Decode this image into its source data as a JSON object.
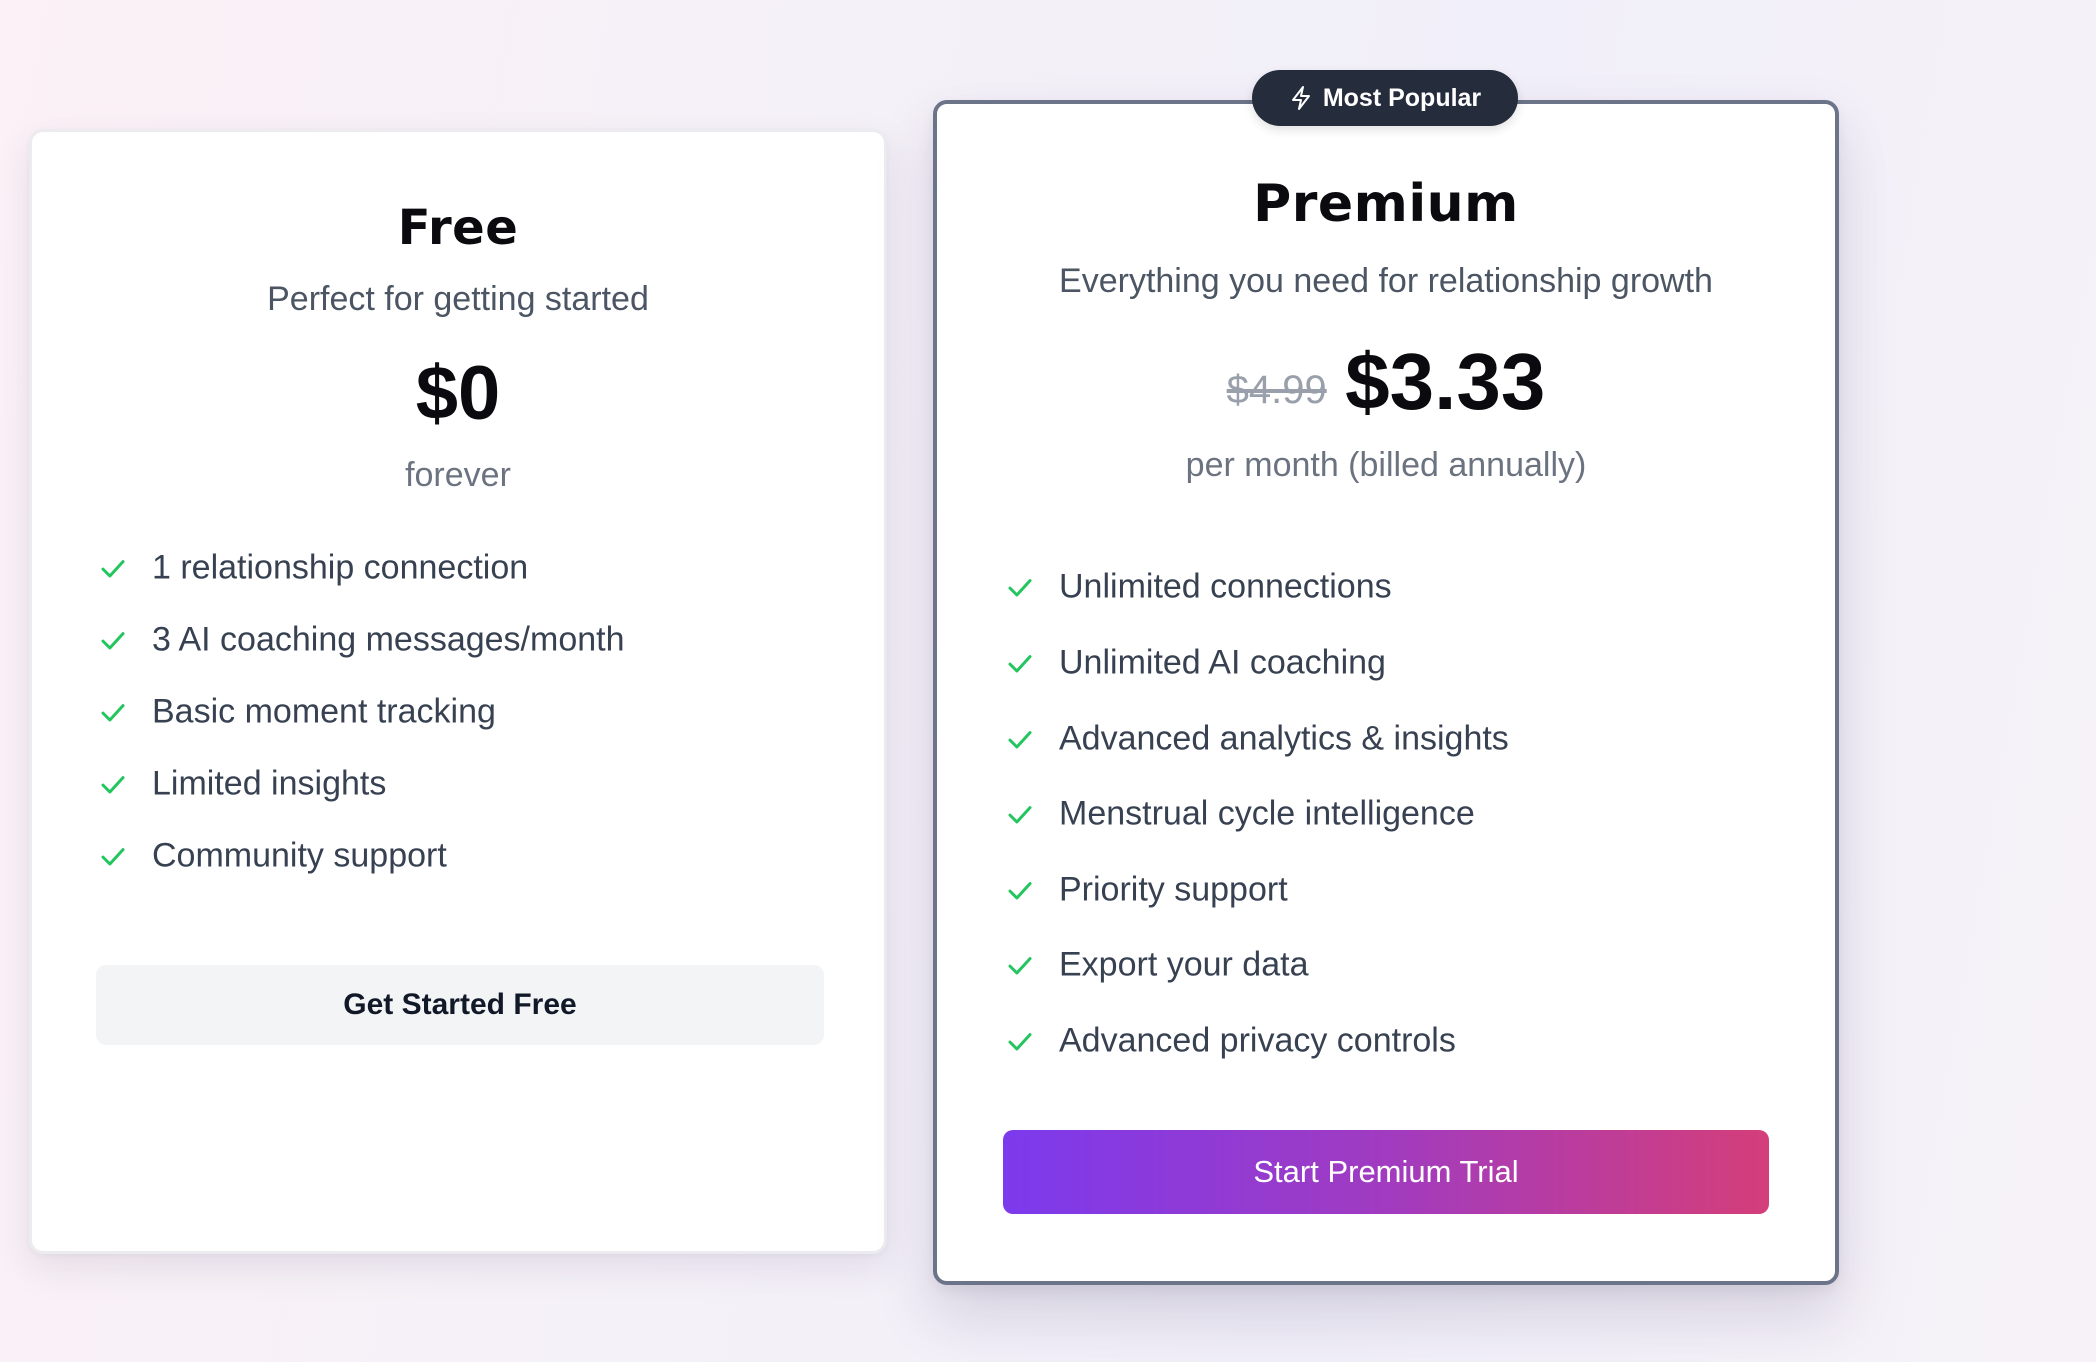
{
  "plans": {
    "free": {
      "name": "Free",
      "description": "Perfect for getting started",
      "price": "$0",
      "period": "forever",
      "features": [
        "1 relationship connection",
        "3 AI coaching messages/month",
        "Basic moment tracking",
        "Limited insights",
        "Community support"
      ],
      "cta": "Get Started Free"
    },
    "premium": {
      "badge": "Most Popular",
      "badge_icon": "lightning-bolt-icon",
      "name": "Premium",
      "description": "Everything you need for relationship growth",
      "old_price": "$4.99",
      "price": "$3.33",
      "period": "per month (billed annually)",
      "features": [
        "Unlimited connections",
        "Unlimited AI coaching",
        "Advanced analytics & insights",
        "Menstrual cycle intelligence",
        "Priority support",
        "Export your data",
        "Advanced privacy controls"
      ],
      "cta": "Start Premium Trial"
    }
  },
  "icons": {
    "feature_check": "check-icon"
  },
  "colors": {
    "check": "#22c55e",
    "premium_gradient_start": "#7c3aed",
    "premium_gradient_end": "#d43e7a",
    "badge_bg": "#252c3b"
  }
}
